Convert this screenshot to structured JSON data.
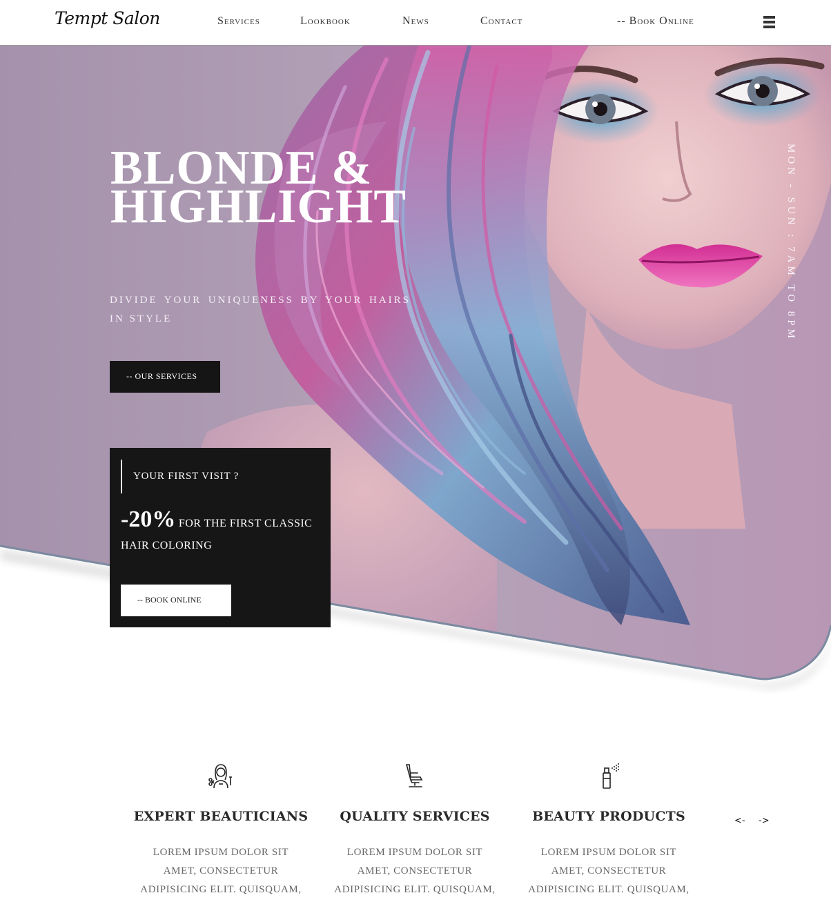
{
  "brand": {
    "logo": "Tempt Salon"
  },
  "nav": {
    "links": [
      "Services",
      "Lookbook",
      "News",
      "Contact"
    ],
    "book": "-- Book Online"
  },
  "hero": {
    "title_line1": "BLONDE &",
    "title_line2": "HIGHLIGHT",
    "subtitle": "Divide your uniqueness by your hairs in style",
    "services_button": "-- Our Services",
    "hours": "Mon - Sun : 7am to 8pm"
  },
  "promo": {
    "heading": "Your First Visit ?",
    "percent": "-20%",
    "text": "for the first classic hair coloring",
    "button": "-- Book Online"
  },
  "features": [
    {
      "icon": "beautician-icon",
      "title": "EXPERT BEAUTICIANS",
      "text": "Lorem ipsum dolor sit amet, consectetur adipisicing elit. Quisquam, quia."
    },
    {
      "icon": "salon-chair-icon",
      "title": "QUALITY SERVICES",
      "text": "Lorem ipsum dolor sit amet, consectetur adipisicing elit. Quisquam, quia."
    },
    {
      "icon": "spray-bottle-icon",
      "title": "BEAUTY PRODUCTS",
      "text": "Lorem ipsum dolor sit amet, consectetur adipisicing elit. Quisquam, quia."
    }
  ],
  "slider": {
    "prev": "<-",
    "next": "->"
  },
  "colors": {
    "hero_bg": "#a892ad",
    "dark": "#161616",
    "hair_pink": "#c0459a",
    "hair_blue": "#6e9ec7",
    "lip": "#e43fa3",
    "skin": "#e9c3c4"
  }
}
